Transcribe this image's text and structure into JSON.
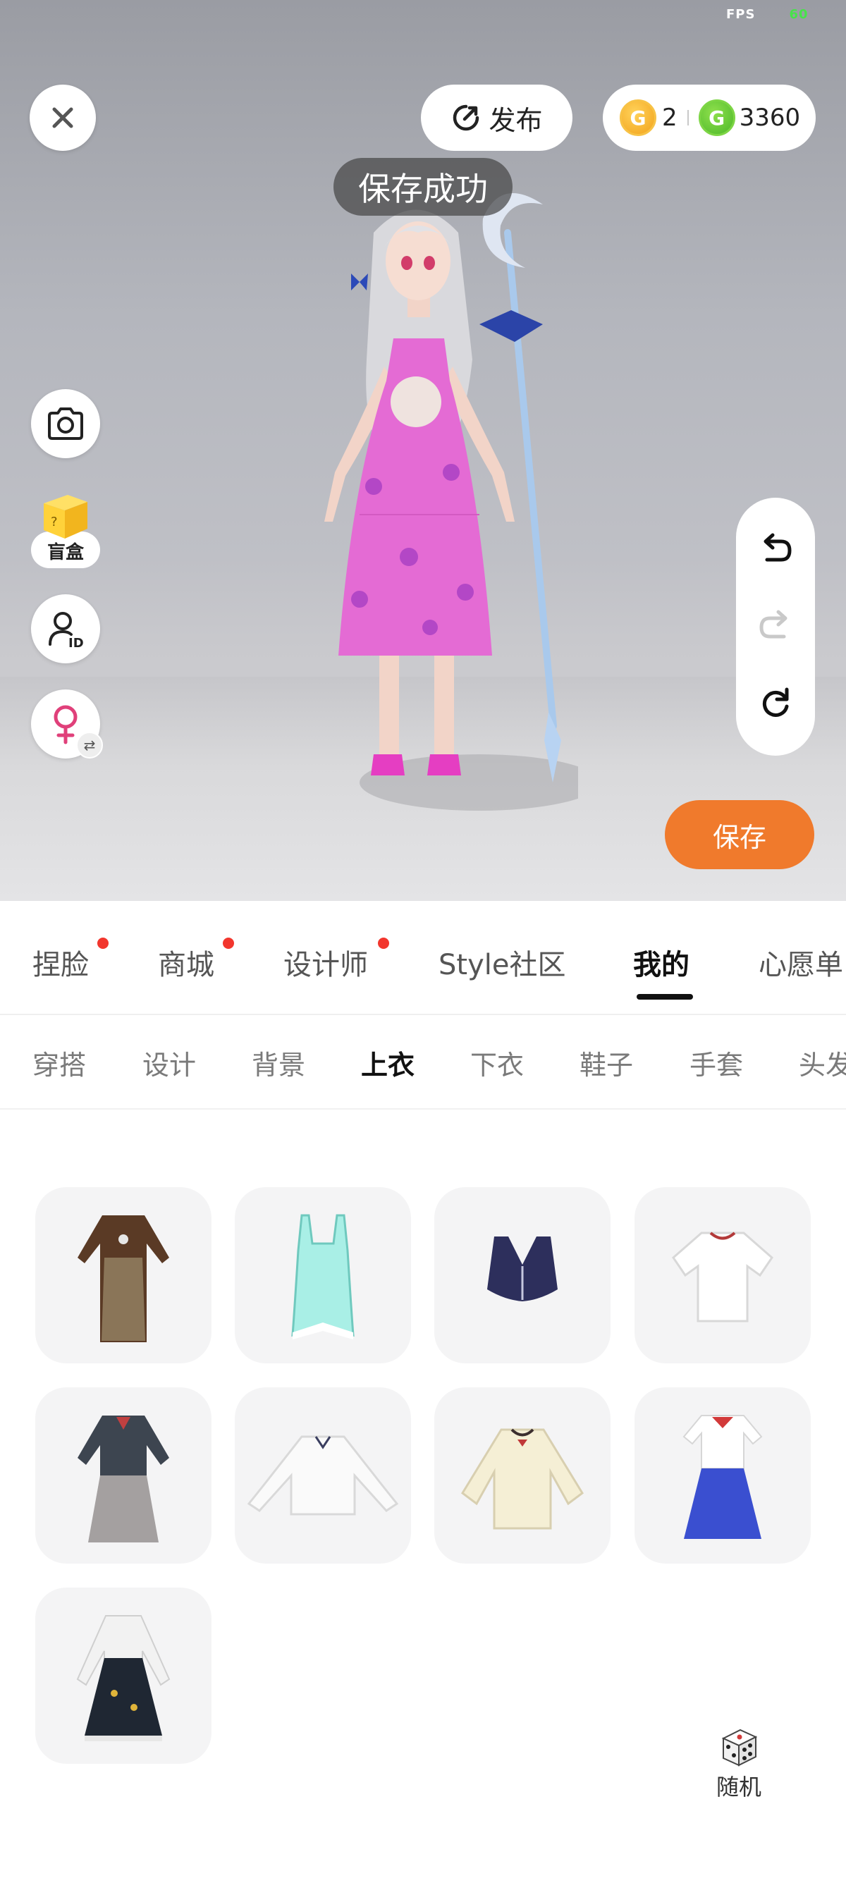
{
  "status": {
    "fps_label": "FPS",
    "fps_value": "60"
  },
  "header": {
    "publish_label": "发布",
    "currency": {
      "gold_amount": "2",
      "green_amount": "3360",
      "gold_icon": "gold-coin-icon",
      "green_icon": "green-coin-icon"
    }
  },
  "toast": {
    "text": "保存成功"
  },
  "side_tools": {
    "blind_box_label": "盲盒"
  },
  "save_button": {
    "label": "保存"
  },
  "main_tabs": [
    {
      "label": "捏脸",
      "badge": true
    },
    {
      "label": "商城",
      "badge": true
    },
    {
      "label": "设计师",
      "badge": true
    },
    {
      "label": "Style社区",
      "badge": false
    },
    {
      "label": "我的",
      "badge": false,
      "active": true
    },
    {
      "label": "心愿单",
      "badge": false
    }
  ],
  "sub_tabs": [
    {
      "label": "穿搭"
    },
    {
      "label": "设计"
    },
    {
      "label": "背景"
    },
    {
      "label": "上衣",
      "active": true
    },
    {
      "label": "下衣"
    },
    {
      "label": "鞋子"
    },
    {
      "label": "手套"
    },
    {
      "label": "头发"
    }
  ],
  "items": [
    {
      "icon": "brown-apron-dress-icon"
    },
    {
      "icon": "aqua-swimsuit-icon"
    },
    {
      "icon": "navy-sports-bra-icon"
    },
    {
      "icon": "white-tshirt-icon"
    },
    {
      "icon": "grey-school-uniform-icon"
    },
    {
      "icon": "white-blouse-icon"
    },
    {
      "icon": "cream-cardigan-icon"
    },
    {
      "icon": "blue-sailor-dress-icon"
    },
    {
      "icon": "black-lolita-dress-icon"
    }
  ],
  "random_button": {
    "label": "随机"
  },
  "colors": {
    "accent": "#f07a2c",
    "badge": "#f2362d",
    "coin_gold": "#f2a31b",
    "coin_green": "#4cb82a"
  }
}
